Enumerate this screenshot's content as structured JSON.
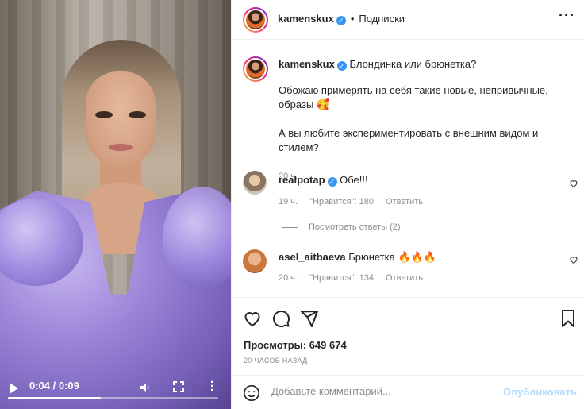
{
  "video": {
    "time": "0:04 / 0:09",
    "progress": 0.44
  },
  "post": {
    "username": "kamenskux",
    "follow_label": "Подписки",
    "dot": "•",
    "more_label": "···"
  },
  "caption": {
    "username": "kamenskux",
    "line1": "Блондинка или брюнетка?",
    "line2": "Обожаю примерять на себя такие новые, непривычные, образы 🥰",
    "line3": "А вы любите экспериментировать с внешним видом и стилем?",
    "time": "20 ч."
  },
  "comments": [
    {
      "username": "realpotap",
      "verified": true,
      "text": "Обе!!!",
      "time": "19 ч.",
      "likes": "\"Нравится\": 180",
      "reply": "Ответить"
    },
    {
      "username": "asel_aitbaeva",
      "verified": false,
      "text": "Брюнетка 🔥🔥🔥",
      "time": "20 ч.",
      "likes": "\"Нравится\": 134",
      "reply": "Ответить"
    }
  ],
  "view_replies": "Посмотреть ответы (2)",
  "stats": {
    "views": "Просмотры: 649 674",
    "posted": "20 ЧАСОВ НАЗАД"
  },
  "add_comment": {
    "placeholder": "Добавьте комментарий...",
    "publish": "Опубликовать"
  },
  "colors": {
    "verified": "#3897f0",
    "publish": "#b3dbff"
  }
}
